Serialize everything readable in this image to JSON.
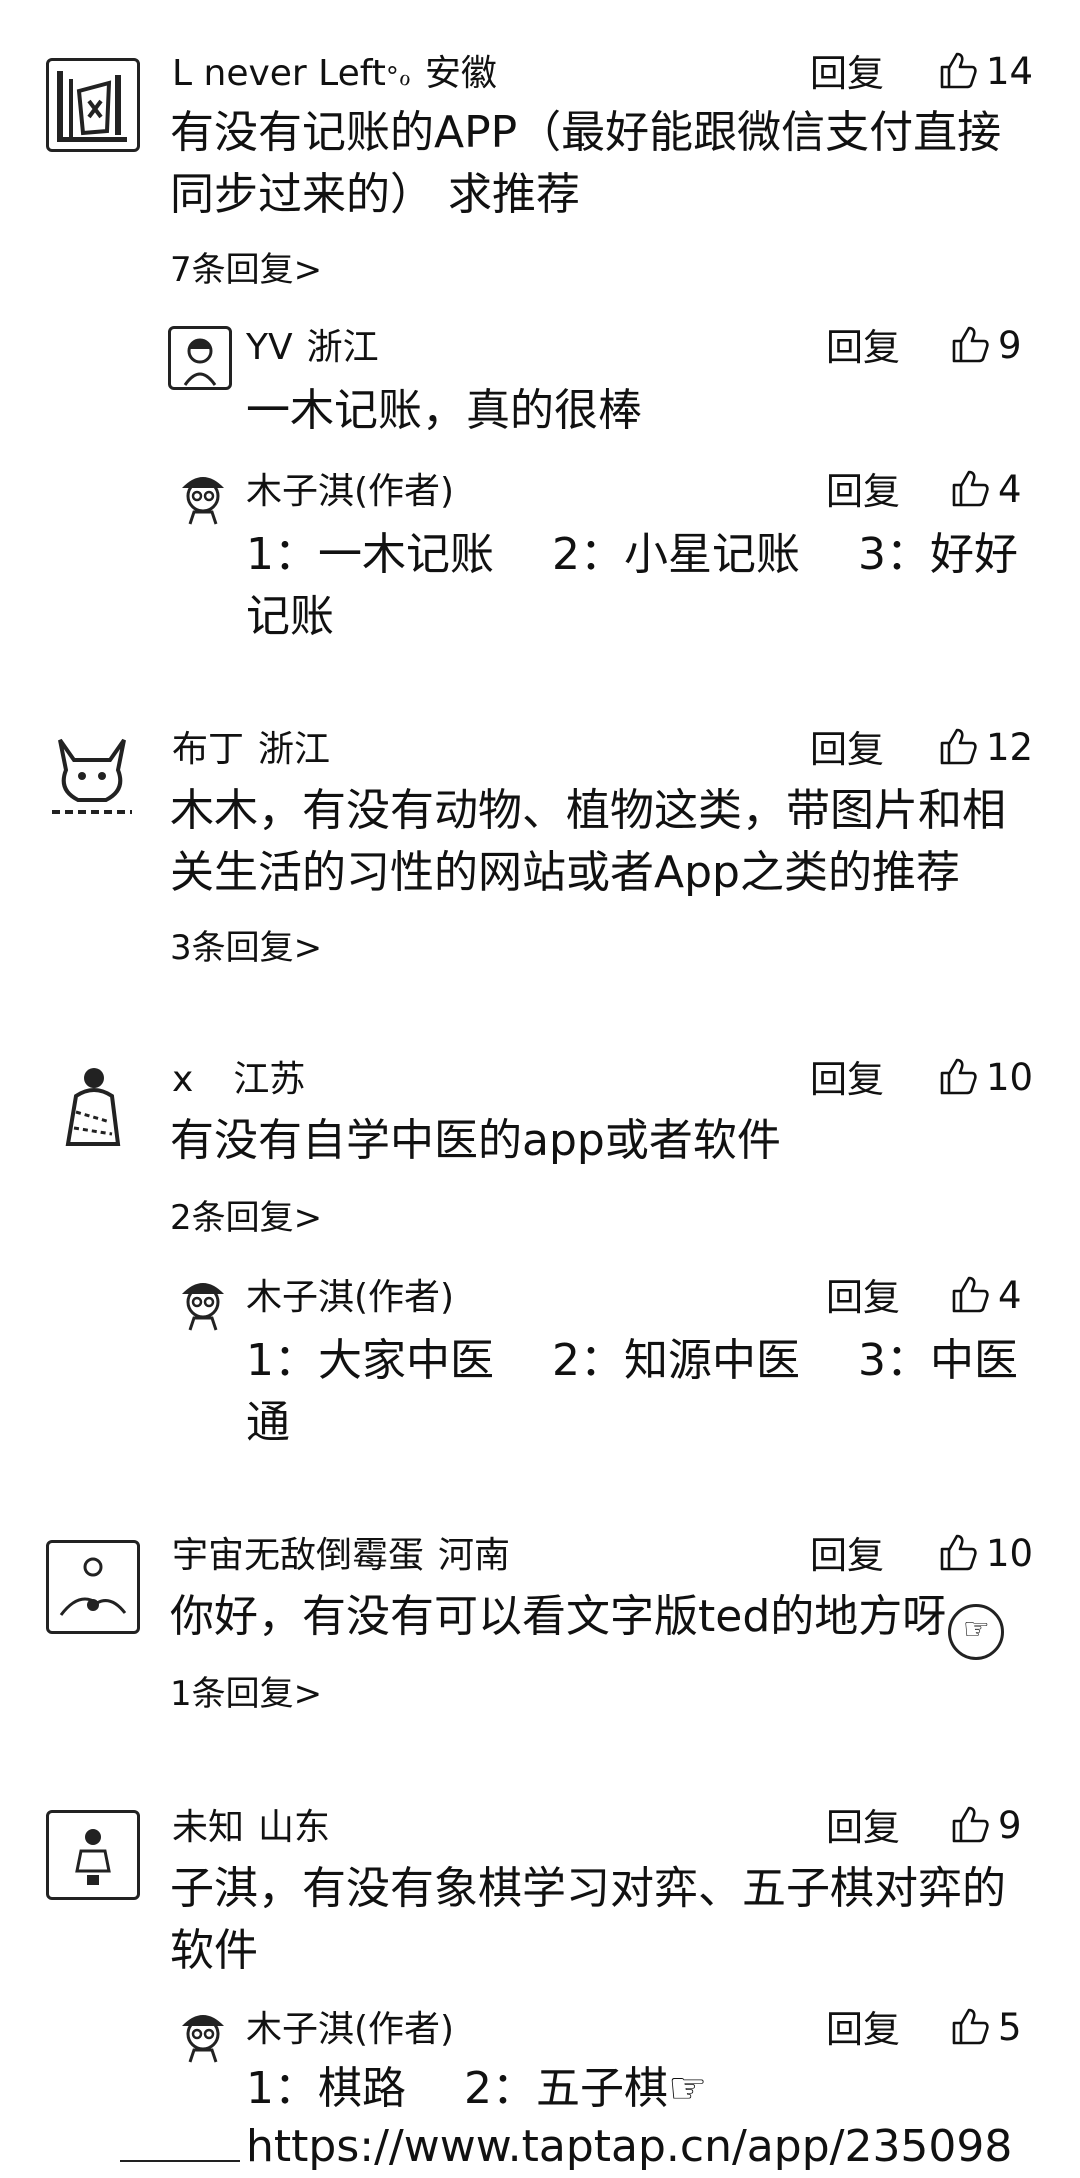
{
  "reply_label": "回复",
  "comments": [
    {
      "user": "L never Left",
      "location": "安徽",
      "likes": "14",
      "content": "有没有记账的APP（最好能跟微信支付直接同步过来的） 求推荐",
      "more_replies": "7条回复>",
      "replies": [
        {
          "user": "YV",
          "location": "浙江",
          "likes": "9",
          "content": "一木记账，真的很棒"
        },
        {
          "user": "木子淇(作者)",
          "location": "",
          "likes": "4",
          "content": "1：一木记账　 2：小星记账　 3：好好记账"
        }
      ]
    },
    {
      "user": "布丁",
      "location": "浙江",
      "likes": "12",
      "content": "木木，有没有动物、植物这类，带图片和相关生活的习性的网站或者App之类的推荐",
      "more_replies": "3条回复>"
    },
    {
      "user": "x",
      "location": "江苏",
      "likes": "10",
      "content": "有没有自学中医的app或者软件",
      "more_replies": "2条回复>",
      "replies": [
        {
          "user": "木子淇(作者)",
          "location": "",
          "likes": "4",
          "content": "1：大家中医　 2：知源中医　 3：中医通"
        }
      ]
    },
    {
      "user": "宇宙无敌倒霉蛋",
      "location": "河南",
      "likes": "10",
      "content": "你好，有没有可以看文字版ted的地方呀",
      "more_replies": "1条回复>"
    },
    {
      "user": "未知",
      "location": "山东",
      "likes": "9",
      "content": "子淇，有没有象棋学习对弈、五子棋对弈的软件",
      "replies": [
        {
          "user": "木子淇(作者)",
          "location": "",
          "likes": "5",
          "content": "1：棋路　 2：五子棋☞",
          "link": "https://www.taptap.cn/app/235098"
        }
      ]
    }
  ]
}
